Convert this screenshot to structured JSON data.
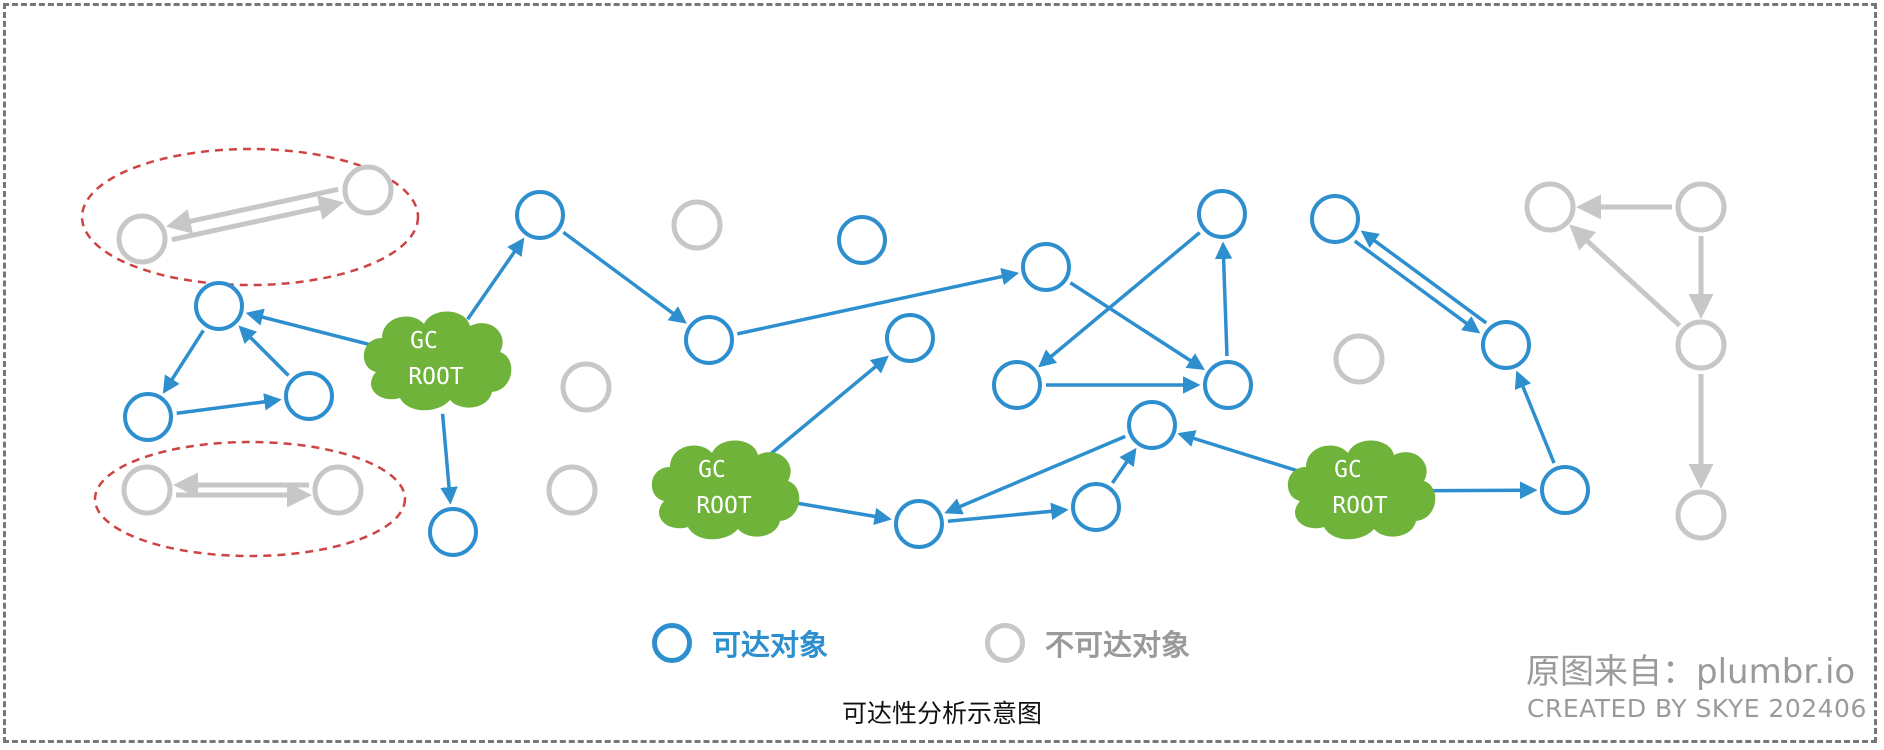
{
  "colors": {
    "reachable": "#2e8fcf",
    "unreachable": "#c7c7c7",
    "gc_root": "#6fb33b",
    "cycle_highlight": "#cc4444"
  },
  "gc_roots": [
    {
      "line1": "GC",
      "line2": "ROOT"
    },
    {
      "line1": "GC",
      "line2": "ROOT"
    },
    {
      "line1": "GC",
      "line2": "ROOT"
    }
  ],
  "legend": {
    "reachable_label": "可达对象",
    "unreachable_label": "不可达对象"
  },
  "caption": "可达性分析示意图",
  "source": "原图来自：plumbr.io",
  "credit": "CREATED BY SKYE 202406"
}
